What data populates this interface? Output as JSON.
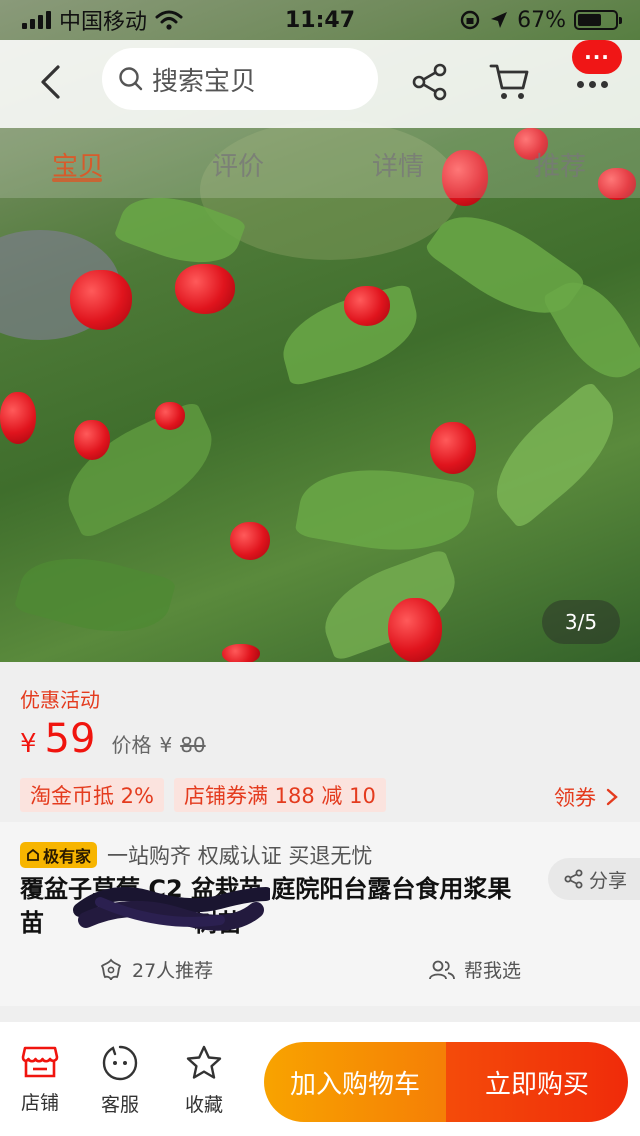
{
  "status_bar": {
    "carrier": "中国移动",
    "time": "11:47",
    "battery_percent": "67%",
    "battery_level": 0.67
  },
  "topnav": {
    "search_placeholder": "搜索宝贝",
    "badge_dots": "···"
  },
  "tabs": [
    {
      "label": "宝贝",
      "active": true
    },
    {
      "label": "评价",
      "active": false
    },
    {
      "label": "详情",
      "active": false
    },
    {
      "label": "推荐",
      "active": false
    }
  ],
  "gallery": {
    "pager": "3/5"
  },
  "promo": {
    "title": "优惠活动",
    "currency": "¥",
    "price": "59",
    "old_label": "价格",
    "old_currency": "¥",
    "old_price": "80",
    "chips": [
      "淘金币抵 2%",
      "店铺券满 188 减 10"
    ],
    "coupon_link": "领券"
  },
  "product": {
    "badge_label": "极有家",
    "badge_text": "一站购齐 权威认证 买退无忧",
    "title": "覆盆子草莓 C2 盆栽苗 庭院阳台露台食用浆果苗",
    "title_tail": "树苗",
    "share_label": "分享",
    "recommend_count": "27人推荐",
    "help_choose": "帮我选"
  },
  "bottombar": {
    "shop_label": "店铺",
    "service_label": "客服",
    "favorite_label": "收藏",
    "cart_button": "加入购物车",
    "buy_button": "立即购买"
  },
  "colors": {
    "accent_red": "#f0140e",
    "promo_text": "#e43b1e",
    "cart_orange": "#f8a300",
    "buy_red": "#f44b0a",
    "badge_yellow": "#f7b500"
  },
  "icons": [
    "back-arrow-icon",
    "search-icon",
    "share-icon",
    "cart-icon",
    "more-icon",
    "chevron-right-icon",
    "share-small-icon",
    "flower-icon",
    "people-icon",
    "shop-icon",
    "service-icon",
    "star-icon",
    "wifi-icon",
    "location-icon",
    "lock-rotation-icon",
    "signal-icon"
  ]
}
